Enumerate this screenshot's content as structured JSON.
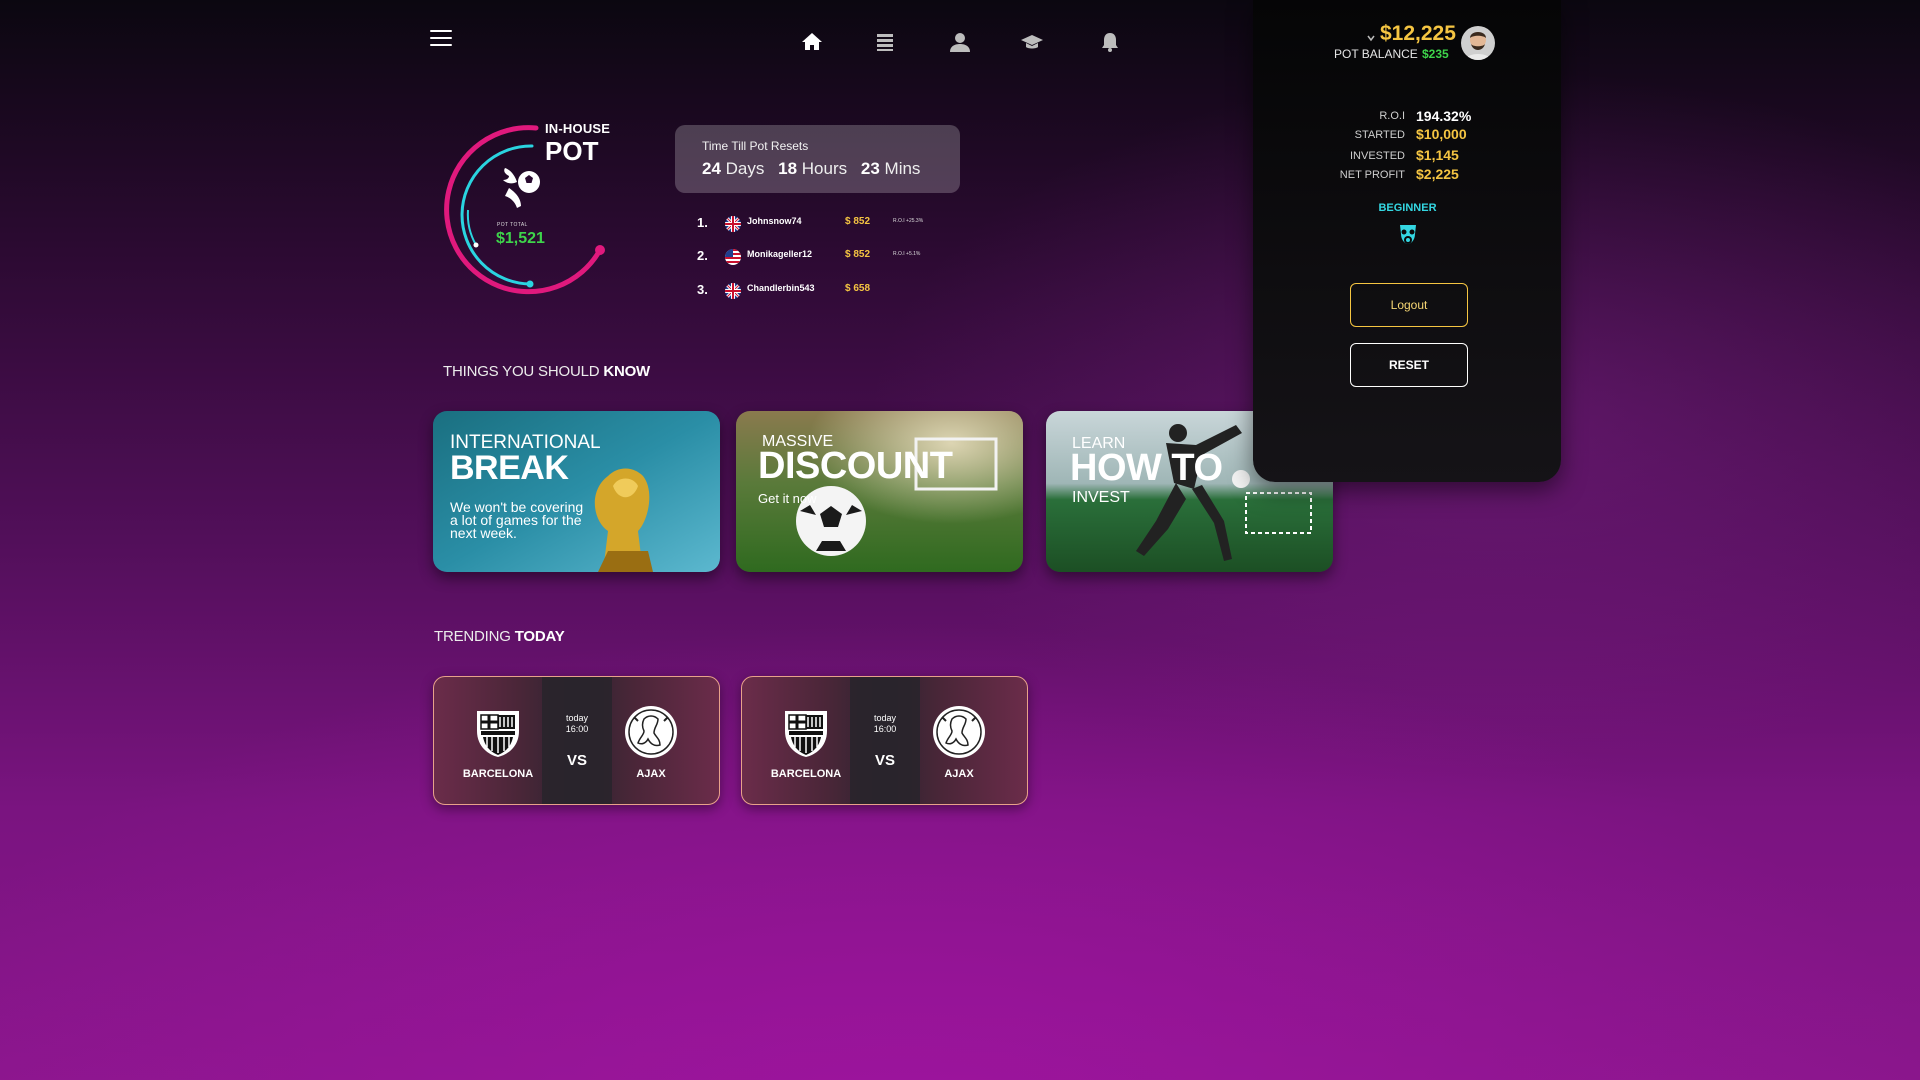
{
  "nav": {
    "menu_icon": "hamburger-menu-icon",
    "icons": [
      "home-icon",
      "list-icon",
      "user-icon",
      "graduation-cap-icon",
      "bell-icon"
    ]
  },
  "pot": {
    "label_small": "IN-HOUSE",
    "label_big": "POT",
    "total_label": "POT TOTAL",
    "total_value": "$1,521",
    "ring_colors": {
      "outer": "#e0197d",
      "inner": "#2ad4e0"
    }
  },
  "timer": {
    "title": "Time Till Pot Resets",
    "days_value": "24",
    "days_unit": "Days",
    "hours_value": "18",
    "hours_unit": "Hours",
    "mins_value": "23",
    "mins_unit": "Mins"
  },
  "leaderboard": [
    {
      "rank": "1.",
      "flag": "uk-flag-icon",
      "name": "Johnsnow74",
      "amount": "$ 852",
      "roi": "R.O.I +25.3%"
    },
    {
      "rank": "2.",
      "flag": "us-flag-icon",
      "name": "Monikageller12",
      "amount": "$ 852",
      "roi": "R.O.I +5.1%"
    },
    {
      "rank": "3.",
      "flag": "uk-flag-icon",
      "name": "Chandlerbin543",
      "amount": "$ 658",
      "roi": ""
    }
  ],
  "things": {
    "title_light": "THINGS YOU SHOULD ",
    "title_bold": "KNOW",
    "cards": [
      {
        "t1": "INTERNATIONAL",
        "t2": "BREAK",
        "t3a": "We won't be covering",
        "t3b": "a lot of games for the",
        "t3c": "next week."
      },
      {
        "t1": "MASSIVE",
        "t2": "DISCOUNT",
        "t3": "Get it now"
      },
      {
        "t1": "LEARN",
        "t2": "HOW TO",
        "t3": "INVEST"
      }
    ]
  },
  "trending": {
    "title_light": "TRENDING ",
    "title_bold": "TODAY",
    "matches": [
      {
        "home": "BARCELONA",
        "away": "AJAX",
        "day": "today",
        "time": "16:00",
        "vs": "VS"
      },
      {
        "home": "BARCELONA",
        "away": "AJAX",
        "day": "today",
        "time": "16:00",
        "vs": "VS"
      }
    ]
  },
  "account": {
    "balance": "$12,225",
    "pot_balance_label": "POT BALANCE",
    "pot_balance_value": "$235",
    "stats": [
      {
        "label": "R.O.I",
        "value": "194.32%",
        "color": "#ffffff"
      },
      {
        "label": "STARTED",
        "value": "$10,000",
        "color": "#f5c542"
      },
      {
        "label": "INVESTED",
        "value": "$1,145",
        "color": "#f5c542"
      },
      {
        "label": "NET PROFIT",
        "value": "$2,225",
        "color": "#f5c542"
      }
    ],
    "level": "BEGINNER",
    "level_icon": "gas-mask-icon",
    "logout_label": "Logout",
    "reset_label": "RESET"
  },
  "colors": {
    "gold": "#f5c542",
    "green": "#3ed44b",
    "cyan": "#34d7e2",
    "pink": "#e0197d"
  }
}
